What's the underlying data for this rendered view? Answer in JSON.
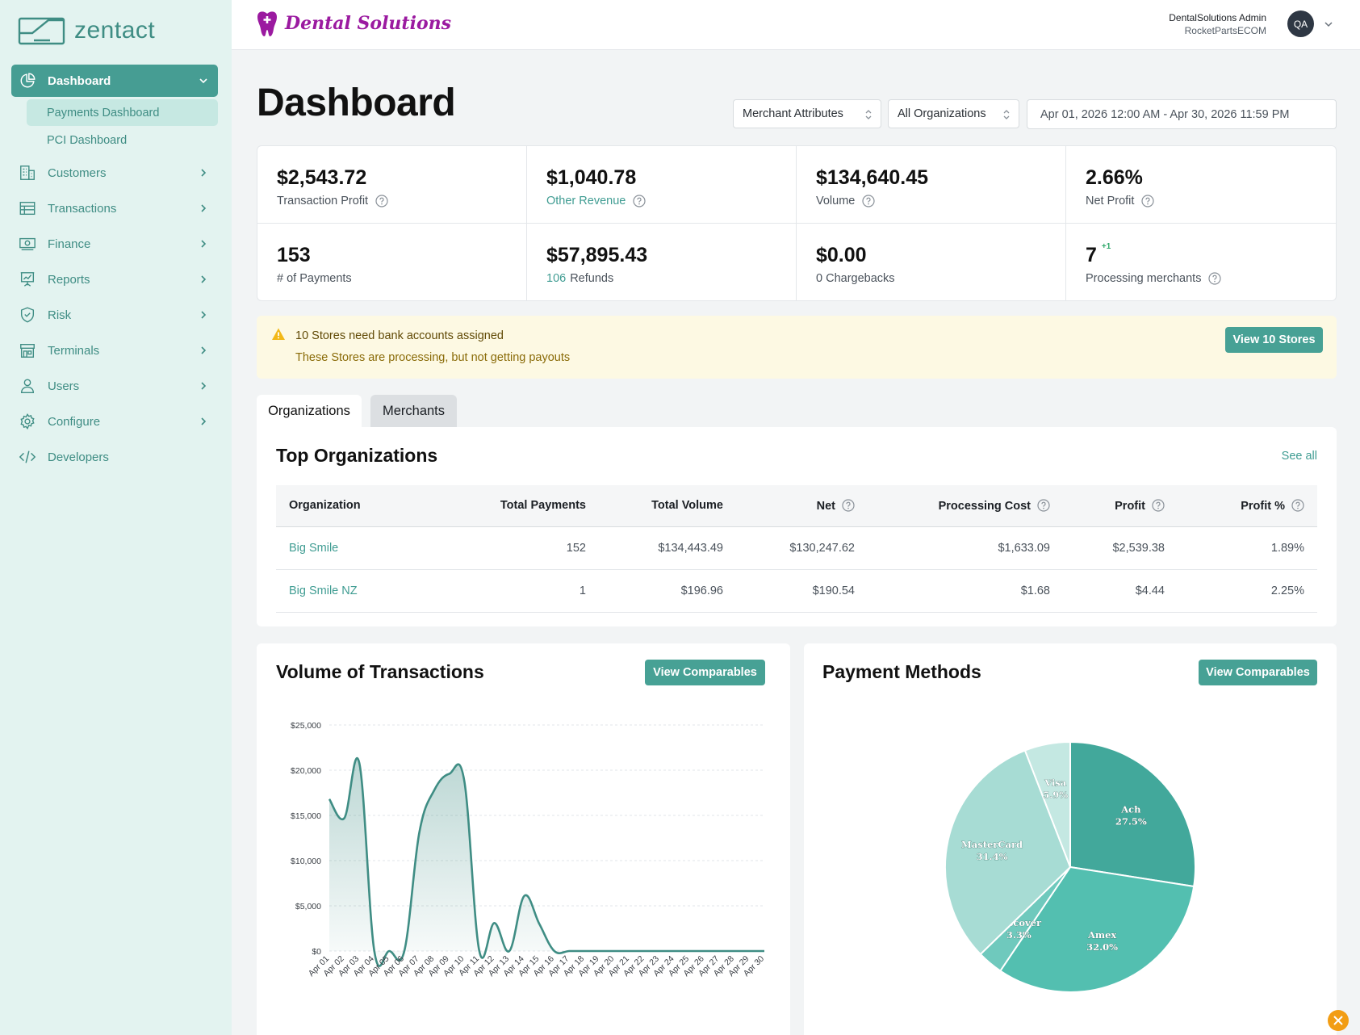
{
  "app": {
    "logo_text": "zentact",
    "brand_name": "Dental Solutions"
  },
  "user": {
    "name": "DentalSolutions Admin",
    "org": "RocketPartsECOM",
    "initials": "QA"
  },
  "sidebar": {
    "dashboard_label": "Dashboard",
    "sub_items": [
      {
        "label": "Payments Dashboard"
      },
      {
        "label": "PCI Dashboard"
      }
    ],
    "items": [
      {
        "label": "Customers",
        "icon": "building-icon"
      },
      {
        "label": "Transactions",
        "icon": "table-icon"
      },
      {
        "label": "Finance",
        "icon": "cash-icon"
      },
      {
        "label": "Reports",
        "icon": "presentation-chart-icon"
      },
      {
        "label": "Risk",
        "icon": "shield-check-icon"
      },
      {
        "label": "Terminals",
        "icon": "storefront-icon"
      },
      {
        "label": "Users",
        "icon": "user-icon"
      },
      {
        "label": "Configure",
        "icon": "gear-icon"
      },
      {
        "label": "Developers",
        "icon": "code-icon"
      }
    ]
  },
  "header": {
    "title": "Dashboard",
    "filter_merchant": "Merchant Attributes",
    "filter_org": "All Organizations",
    "date_range": "Apr 01, 2026 12:00 AM - Apr 30, 2026 11:59 PM"
  },
  "metrics": [
    {
      "value": "$2,543.72",
      "label": "Transaction Profit"
    },
    {
      "value": "$1,040.78",
      "label": "Other Revenue"
    },
    {
      "value": "$134,640.45",
      "label": "Volume"
    },
    {
      "value": "2.66%",
      "label": "Net Profit"
    },
    {
      "value": "153",
      "label": "# of Payments"
    },
    {
      "value": "$57,895.43",
      "label_count": "106",
      "label": "Refunds"
    },
    {
      "value": "$0.00",
      "label": "0 Chargebacks"
    },
    {
      "value": "7",
      "badge": "+1",
      "label": "Processing merchants"
    }
  ],
  "alert": {
    "title": "10 Stores need bank accounts assigned",
    "description": "These Stores are processing, but not getting payouts",
    "button": "View 10 Stores"
  },
  "tabs": [
    {
      "label": "Organizations"
    },
    {
      "label": "Merchants"
    }
  ],
  "top_orgs": {
    "title": "Top Organizations",
    "see_all": "See all",
    "columns": [
      "Organization",
      "Total Payments",
      "Total Volume",
      "Net",
      "Processing Cost",
      "Profit",
      "Profit %"
    ],
    "rows": [
      [
        "Big Smile",
        "152",
        "$134,443.49",
        "$130,247.62",
        "$1,633.09",
        "$2,539.38",
        "1.89%"
      ],
      [
        "Big Smile NZ",
        "1",
        "$196.96",
        "$190.54",
        "$1.68",
        "$4.44",
        "2.25%"
      ]
    ]
  },
  "volume_card": {
    "title": "Volume of Transactions",
    "button": "View Comparables"
  },
  "payment_card": {
    "title": "Payment Methods",
    "button": "View Comparables"
  },
  "chart_data": [
    {
      "type": "area",
      "title": "Volume of Transactions",
      "y_ticks": [
        "$0",
        "$5,000",
        "$10,000",
        "$15,000",
        "$20,000",
        "$25,000"
      ],
      "ylim": [
        0,
        25000
      ],
      "grid": true,
      "x": [
        "Apr 01",
        "Apr 02",
        "Apr 03",
        "Apr 04",
        "Apr 05",
        "Apr 06",
        "Apr 07",
        "Apr 08",
        "Apr 09",
        "Apr 10",
        "Apr 11",
        "Apr 12",
        "Apr 13",
        "Apr 14",
        "Apr 15",
        "Apr 16",
        "Apr 17",
        "Apr 18",
        "Apr 19",
        "Apr 20",
        "Apr 21",
        "Apr 22",
        "Apr 23",
        "Apr 24",
        "Apr 25",
        "Apr 26",
        "Apr 27",
        "Apr 28",
        "Apr 29",
        "Apr 30"
      ],
      "values": [
        16800,
        14700,
        20800,
        0,
        0,
        0,
        13100,
        17800,
        19600,
        18800,
        0,
        3100,
        0,
        6100,
        3000,
        0,
        0,
        0,
        0,
        0,
        0,
        0,
        0,
        0,
        0,
        0,
        0,
        0,
        0,
        0
      ],
      "color": "#3f8d84"
    },
    {
      "type": "pie",
      "title": "Payment Methods",
      "slices": [
        {
          "label": "Ach",
          "pct_label": "27.5%",
          "value": 27.5,
          "color": "#42a89b"
        },
        {
          "label": "Amex",
          "pct_label": "32.0%",
          "value": 32.0,
          "color": "#53bfb0"
        },
        {
          "label": "Discover",
          "pct_label": "3.3%",
          "value": 3.3,
          "color": "#6fc9bd"
        },
        {
          "label": "MasterCard",
          "pct_label": "31.4%",
          "value": 31.4,
          "color": "#a7dcd4"
        },
        {
          "label": "Visa",
          "pct_label": "5.9%",
          "value": 5.9,
          "color": "#c4e8e2"
        }
      ]
    }
  ]
}
